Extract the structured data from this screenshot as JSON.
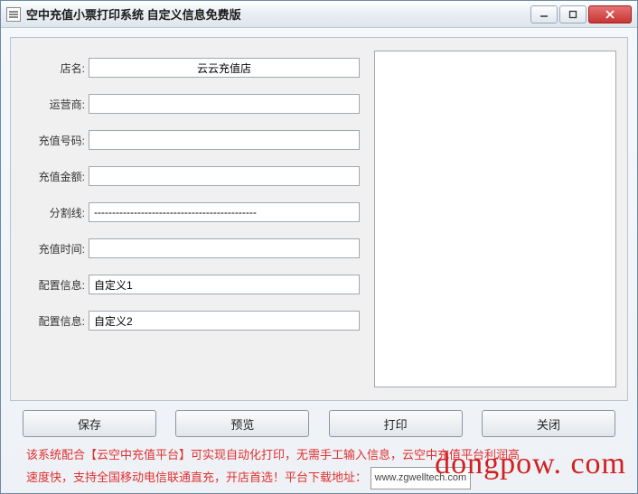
{
  "window": {
    "title": "空中充值小票打印系统 自定义信息免费版"
  },
  "form": {
    "fields": [
      {
        "label": "店名:",
        "value": "云云充值店",
        "center": true
      },
      {
        "label": "运营商:",
        "value": ""
      },
      {
        "label": "充值号码:",
        "value": ""
      },
      {
        "label": "充值金额:",
        "value": ""
      },
      {
        "label": "分割线:",
        "value": "---------------------------------------------"
      },
      {
        "label": "充值时间:",
        "value": ""
      },
      {
        "label": "配置信息:",
        "value": "自定义1"
      },
      {
        "label": "配置信息:",
        "value": "自定义2"
      }
    ]
  },
  "buttons": {
    "save": "保存",
    "preview": "预览",
    "print": "打印",
    "close": "关闭"
  },
  "footer": {
    "line1": "该系统配合【云空中充值平台】可实现自动化打印，无需手工输入信息，云空中充值平台利润高",
    "line2a": "速度快，支持全国移动电信联通直充，开店首选！平台下载地址：",
    "url": "www.zgwelltech.com"
  },
  "watermark": "dongpow. com"
}
